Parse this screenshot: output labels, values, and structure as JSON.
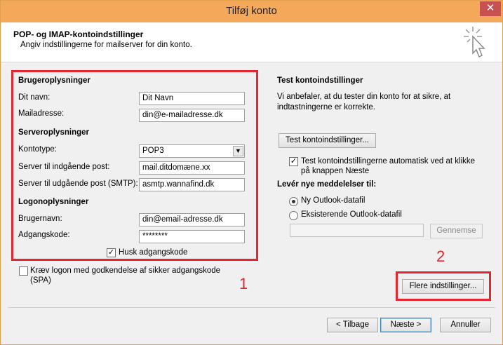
{
  "window": {
    "title": "Tilføj konto",
    "close_symbol": "✕"
  },
  "header": {
    "title": "POP- og IMAP-kontoindstillinger",
    "subtitle": "Angiv indstillingerne for mailserver for din konto."
  },
  "user_info": {
    "heading": "Brugeroplysninger",
    "name_label": "Dit navn:",
    "name_value": "Dit Navn",
    "email_label": "Mailadresse:",
    "email_value": "din@e-mailadresse.dk"
  },
  "server_info": {
    "heading": "Serveroplysninger",
    "account_type_label": "Kontotype:",
    "account_type_value": "POP3",
    "incoming_label": "Server til indgående post:",
    "incoming_value": "mail.ditdomæne.xx",
    "outgoing_label": "Server til udgående post (SMTP):",
    "outgoing_value": "asmtp.wannafind.dk"
  },
  "logon_info": {
    "heading": "Logonoplysninger",
    "username_label": "Brugernavn:",
    "username_value": "din@email-adresse.dk",
    "password_label": "Adgangskode:",
    "password_value": "********",
    "remember_label": "Husk adgangskode"
  },
  "spa_label": "Kræv logon med godkendelse af sikker adgangskode (SPA)",
  "test": {
    "heading": "Test kontoindstillinger",
    "description": "Vi anbefaler, at du tester din konto for at sikre, at indtastningerne er korrekte.",
    "button": "Test kontoindstillinger...",
    "auto_label": "Test kontoindstillingerne automatisk ved at klikke på knappen Næste"
  },
  "deliver": {
    "heading": "Levér nye meddelelser til:",
    "option_new": "Ny Outlook-datafil",
    "option_existing": "Eksisterende Outlook-datafil",
    "browse": "Gennemse"
  },
  "more_settings": "Flere indstillinger...",
  "annotations": {
    "one": "1",
    "two": "2"
  },
  "footer": {
    "back": "< Tilbage",
    "next": "Næste >",
    "cancel": "Annuller"
  },
  "colors": {
    "title_bar": "#f4a85a",
    "annotation_red": "#e3262f"
  }
}
